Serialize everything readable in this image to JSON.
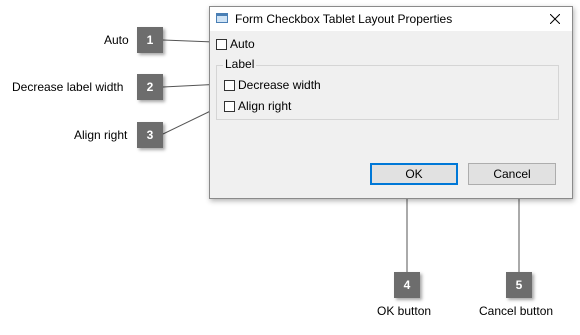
{
  "dialog": {
    "title": "Form Checkbox Tablet Layout Properties",
    "auto_label": "Auto",
    "group_label": "Label",
    "decrease_width_label": "Decrease width",
    "align_right_label": "Align right",
    "ok_label": "OK",
    "cancel_label": "Cancel"
  },
  "callouts": [
    {
      "number": "1",
      "text": "Auto"
    },
    {
      "number": "2",
      "text": "Decrease label width"
    },
    {
      "number": "3",
      "text": "Align right"
    },
    {
      "number": "4",
      "text": "OK button"
    },
    {
      "number": "5",
      "text": "Cancel button"
    }
  ],
  "colors": {
    "badge": "#6d6d6d",
    "dialog_bg": "#f0f0f0",
    "default_button_border": "#0078d7"
  }
}
